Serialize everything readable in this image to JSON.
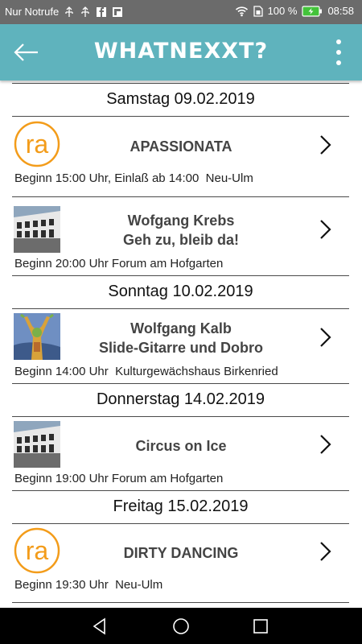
{
  "status": {
    "carrier": "Nur Notrufe",
    "battery": "100 %",
    "time": "08:58"
  },
  "appbar": {
    "title": "WHATNEXXT?",
    "back_icon": "arrow-left-icon",
    "menu_icon": "more-vertical-icon"
  },
  "colors": {
    "appbar": "#5fb3bd",
    "statusbar": "#6b6b6b",
    "ra_logo": "#f39c1a"
  },
  "days": [
    {
      "date": "Samstag 09.02.2019",
      "events": [
        {
          "thumb": "ra-logo",
          "thumb_text": "ra",
          "title": "APASSIONATA",
          "info": "Beginn 15:00 Uhr, Einlaß ab 14:00  Neu-Ulm"
        },
        {
          "thumb": "building-photo",
          "title_lines": [
            "Wofgang Krebs",
            "Geh zu, bleib da!"
          ],
          "info": "Beginn 20:00 Uhr Forum am Hofgarten"
        }
      ]
    },
    {
      "date": "Sonntag 10.02.2019",
      "events": [
        {
          "thumb": "performer-photo",
          "title_lines": [
            "Wolfgang Kalb",
            "Slide-Gitarre und Dobro"
          ],
          "info": "Beginn 14:00 Uhr  Kulturgewächshaus Birkenried"
        }
      ]
    },
    {
      "date": "Donnerstag 14.02.2019",
      "events": [
        {
          "thumb": "building-photo",
          "title": "Circus on Ice",
          "info": "Beginn 19:00 Uhr Forum am Hofgarten"
        }
      ]
    },
    {
      "date": "Freitag 15.02.2019",
      "events": [
        {
          "thumb": "ra-logo",
          "thumb_text": "ra",
          "title": "DIRTY DANCING",
          "info": "Beginn 19:30 Uhr  Neu-Ulm"
        }
      ]
    }
  ]
}
